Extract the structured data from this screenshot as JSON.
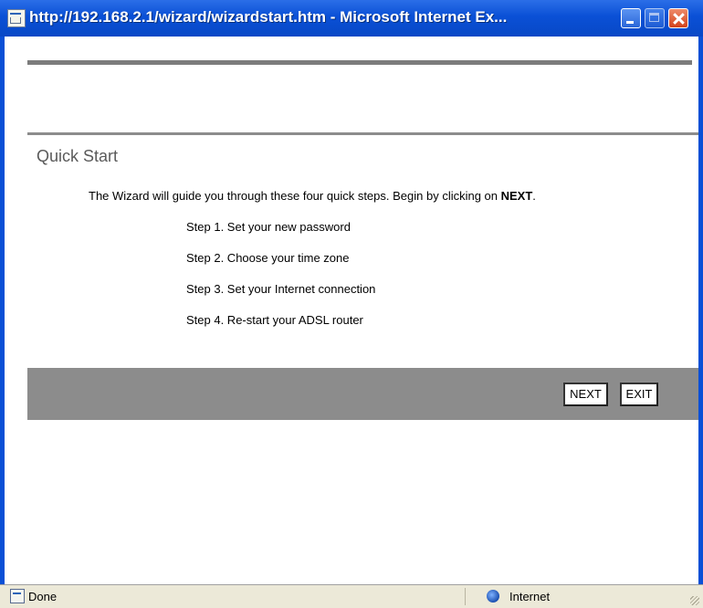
{
  "window": {
    "title": "http://192.168.2.1/wizard/wizardstart.htm - Microsoft Internet Ex..."
  },
  "page": {
    "section_title": "Quick Start",
    "intro_text": "The Wizard will guide you through these four quick steps. Begin by clicking on ",
    "intro_bold": "NEXT",
    "intro_end": ".",
    "steps": [
      "Step 1. Set your new password",
      "Step 2. Choose your time zone",
      "Step 3. Set your Internet connection",
      "Step 4. Re-start your ADSL router"
    ],
    "buttons": {
      "next": "NEXT",
      "exit": "EXIT"
    }
  },
  "statusbar": {
    "status": "Done",
    "zone": "Internet"
  },
  "icons": {
    "window": "page-icon",
    "status": "page-done-icon",
    "zone": "internet-globe-icon"
  },
  "colors": {
    "titlebar": "#0a50d6",
    "rule": "#7c7c7c",
    "button_bar": "#8c8c8c",
    "section_title": "#5a5a5a"
  }
}
